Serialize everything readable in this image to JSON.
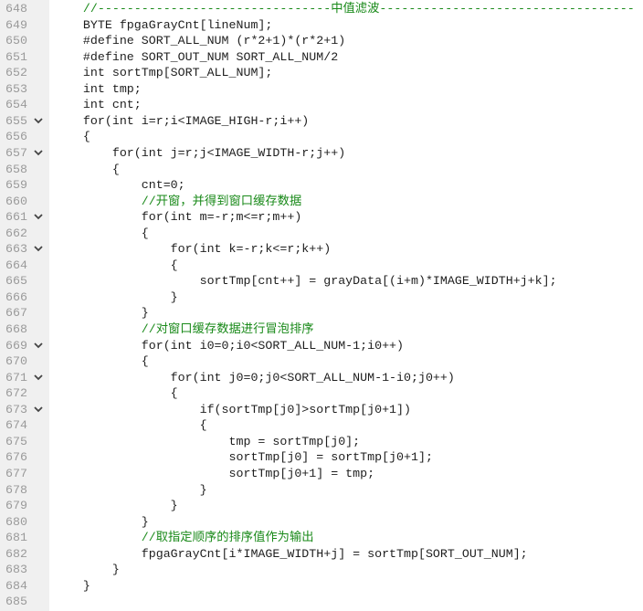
{
  "editor": {
    "lines": [
      {
        "num": "648",
        "fold": false,
        "code": "    //--------------------------------中值滤波-----------------------------------"
      },
      {
        "num": "649",
        "fold": false,
        "code": "    BYTE fpgaGrayCnt[lineNum];"
      },
      {
        "num": "650",
        "fold": false,
        "code": "    #define SORT_ALL_NUM (r*2+1)*(r*2+1)"
      },
      {
        "num": "651",
        "fold": false,
        "code": "    #define SORT_OUT_NUM SORT_ALL_NUM/2"
      },
      {
        "num": "652",
        "fold": false,
        "code": "    int sortTmp[SORT_ALL_NUM];"
      },
      {
        "num": "653",
        "fold": false,
        "code": "    int tmp;"
      },
      {
        "num": "654",
        "fold": false,
        "code": "    int cnt;"
      },
      {
        "num": "655",
        "fold": true,
        "code": "    for(int i=r;i<IMAGE_HIGH-r;i++)"
      },
      {
        "num": "656",
        "fold": false,
        "code": "    {"
      },
      {
        "num": "657",
        "fold": true,
        "code": "        for(int j=r;j<IMAGE_WIDTH-r;j++)"
      },
      {
        "num": "658",
        "fold": false,
        "code": "        {"
      },
      {
        "num": "659",
        "fold": false,
        "code": "            cnt=0;"
      },
      {
        "num": "660",
        "fold": false,
        "code": "            //开窗，并得到窗口缓存数据"
      },
      {
        "num": "661",
        "fold": true,
        "code": "            for(int m=-r;m<=r;m++)"
      },
      {
        "num": "662",
        "fold": false,
        "code": "            {"
      },
      {
        "num": "663",
        "fold": true,
        "code": "                for(int k=-r;k<=r;k++)"
      },
      {
        "num": "664",
        "fold": false,
        "code": "                {"
      },
      {
        "num": "665",
        "fold": false,
        "code": "                    sortTmp[cnt++] = grayData[(i+m)*IMAGE_WIDTH+j+k];"
      },
      {
        "num": "666",
        "fold": false,
        "code": "                }"
      },
      {
        "num": "667",
        "fold": false,
        "code": "            }"
      },
      {
        "num": "668",
        "fold": false,
        "code": "            //对窗口缓存数据进行冒泡排序"
      },
      {
        "num": "669",
        "fold": true,
        "code": "            for(int i0=0;i0<SORT_ALL_NUM-1;i0++)"
      },
      {
        "num": "670",
        "fold": false,
        "code": "            {"
      },
      {
        "num": "671",
        "fold": true,
        "code": "                for(int j0=0;j0<SORT_ALL_NUM-1-i0;j0++)"
      },
      {
        "num": "672",
        "fold": false,
        "code": "                {"
      },
      {
        "num": "673",
        "fold": true,
        "code": "                    if(sortTmp[j0]>sortTmp[j0+1])"
      },
      {
        "num": "674",
        "fold": false,
        "code": "                    {"
      },
      {
        "num": "675",
        "fold": false,
        "code": "                        tmp = sortTmp[j0];"
      },
      {
        "num": "676",
        "fold": false,
        "code": "                        sortTmp[j0] = sortTmp[j0+1];"
      },
      {
        "num": "677",
        "fold": false,
        "code": "                        sortTmp[j0+1] = tmp;"
      },
      {
        "num": "678",
        "fold": false,
        "code": "                    }"
      },
      {
        "num": "679",
        "fold": false,
        "code": "                }"
      },
      {
        "num": "680",
        "fold": false,
        "code": "            }"
      },
      {
        "num": "681",
        "fold": false,
        "code": "            //取指定顺序的排序值作为输出"
      },
      {
        "num": "682",
        "fold": false,
        "code": "            fpgaGrayCnt[i*IMAGE_WIDTH+j] = sortTmp[SORT_OUT_NUM];"
      },
      {
        "num": "683",
        "fold": false,
        "code": "        }"
      },
      {
        "num": "684",
        "fold": false,
        "code": "    }"
      },
      {
        "num": "685",
        "fold": false,
        "code": ""
      }
    ]
  },
  "colors": {
    "gutter_bg": "#f0f0f0",
    "line_number": "#9a9a9a",
    "keyword": "#8b6914",
    "macro": "#3030b0",
    "comment": "#1a8a1a",
    "number": "#2a3fc0",
    "text": "#1e1e1e"
  },
  "icons": {
    "fold": "chevron-down-icon"
  }
}
